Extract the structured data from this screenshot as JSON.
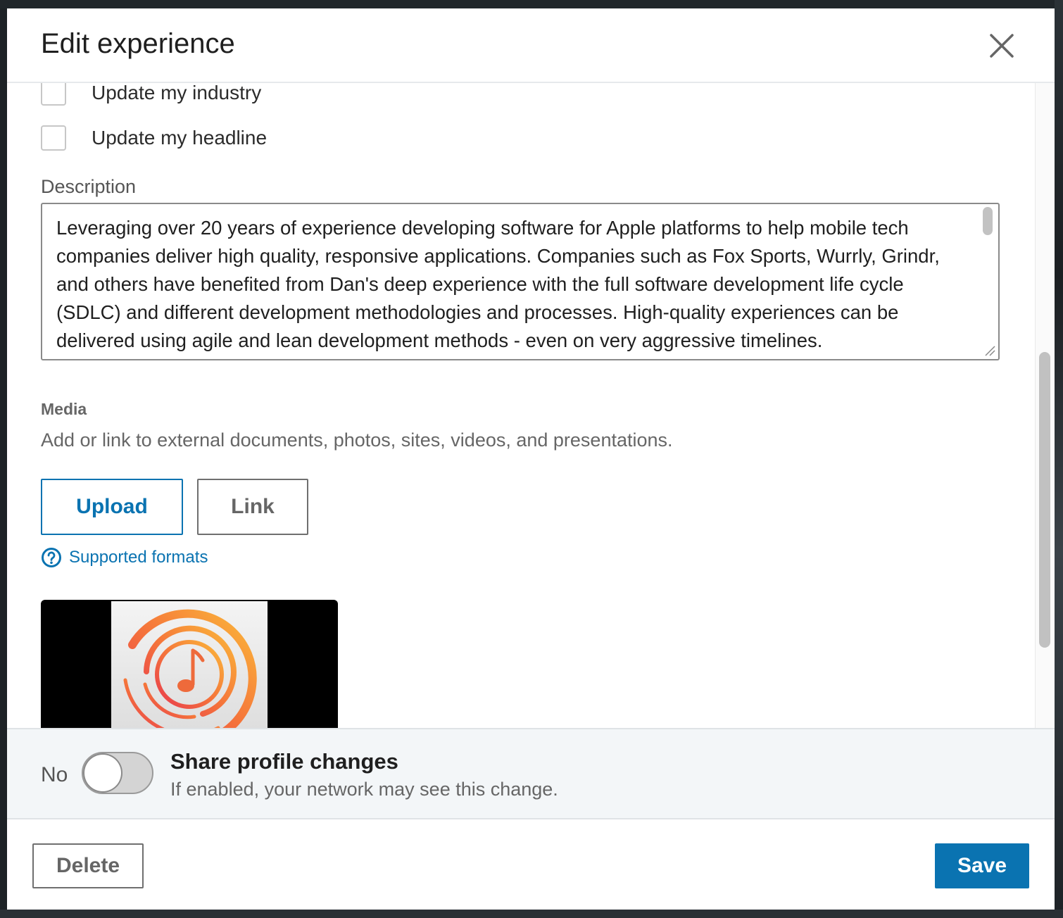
{
  "modal": {
    "title": "Edit experience",
    "close_icon": "close-icon"
  },
  "form": {
    "checkboxes": [
      {
        "label": "Update my industry",
        "checked": false
      },
      {
        "label": "Update my headline",
        "checked": false
      }
    ],
    "description": {
      "label": "Description",
      "value": "Leveraging over 20 years of experience developing software for Apple platforms to help mobile tech\ncompanies deliver high quality, responsive applications. Companies such as Fox Sports, Wurrly, Grindr,\nand others have benefited from Dan's deep experience with the full software development life cycle\n(SDLC) and different development methodologies and processes. High-quality experiences can be\ndelivered using agile and lean development methods - even on very aggressive timelines."
    },
    "media": {
      "title": "Media",
      "description": "Add or link to external documents, photos, sites, videos, and presentations.",
      "upload_label": "Upload",
      "link_label": "Link",
      "supported_formats_label": "Supported formats",
      "help_icon": "help-circle-icon",
      "thumbnail_icon": "music-note-icon"
    }
  },
  "share": {
    "toggle_state": "No",
    "toggle_on": false,
    "title": "Share profile changes",
    "subtitle": "If enabled, your network may see this change."
  },
  "footer": {
    "delete_label": "Delete",
    "save_label": "Save"
  },
  "colors": {
    "accent": "#0a73b1",
    "share_bar_bg": "#f3f6f8"
  }
}
